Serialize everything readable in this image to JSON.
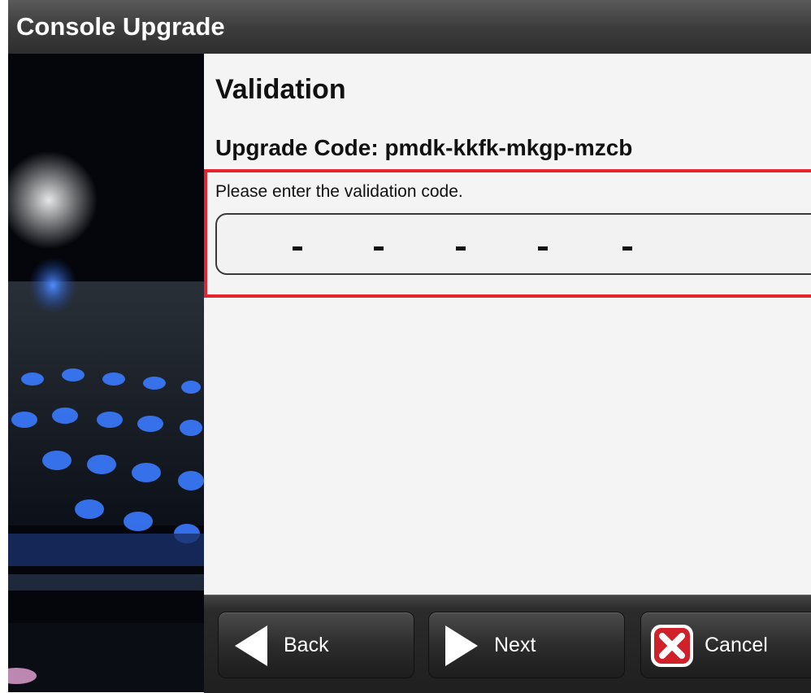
{
  "window": {
    "title": "Console Upgrade"
  },
  "page": {
    "heading": "Validation",
    "upgrade_code": "Upgrade Code: pmdk-kkfk-mkgp-mzcb",
    "prompt": "Please enter the validation code.",
    "validation_input": {
      "segments": [
        "",
        "",
        "",
        "",
        "",
        ""
      ],
      "separator": "-"
    }
  },
  "buttons": {
    "back": {
      "label": "Back",
      "icon": "arrow-left-icon"
    },
    "next": {
      "label": "Next",
      "icon": "arrow-right-icon"
    },
    "cancel": {
      "label": "Cancel",
      "icon": "cancel-x-icon"
    }
  },
  "colors": {
    "highlight_frame": "#e4242f",
    "cancel_icon": "#d0202a",
    "titlebar": "#3d3d3d"
  }
}
